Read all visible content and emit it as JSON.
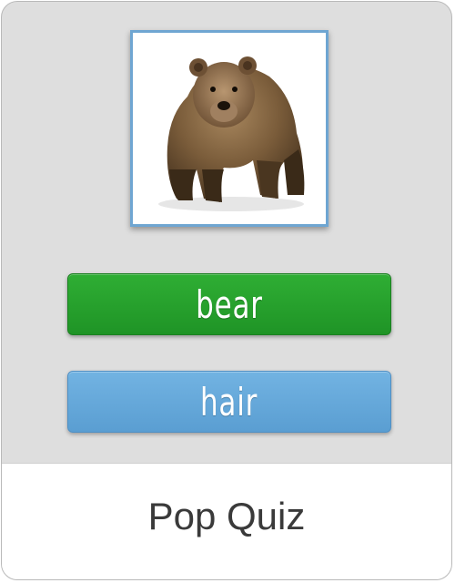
{
  "quiz": {
    "image_icon": "bear-photo",
    "answers": [
      {
        "label": "bear",
        "color": "#28a22e"
      },
      {
        "label": "hair",
        "color": "#65aadb"
      }
    ]
  },
  "footer": {
    "title": "Pop Quiz"
  }
}
